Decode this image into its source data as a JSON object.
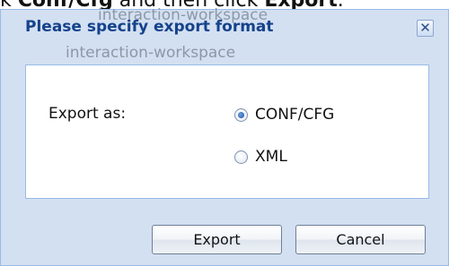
{
  "background": {
    "instruction_prefix": "k ",
    "instruction_bold1": "Conf/Cfg",
    "instruction_mid": " and then click ",
    "instruction_bold2": "Export",
    "instruction_suffix": ".",
    "ghost_text_1": "interaction-workspace",
    "ghost_text_2": "interaction-workspace"
  },
  "dialog": {
    "title": "Please specify export format",
    "close_glyph": "✕",
    "export_label": "Export as:",
    "options": [
      {
        "label": "CONF/CFG",
        "selected": true
      },
      {
        "label": "XML",
        "selected": false
      }
    ],
    "export_button": "Export",
    "cancel_button": "Cancel"
  },
  "colors": {
    "title": "#15428b",
    "dialog_bg": "#d3e0f1",
    "border": "#99bbe8"
  }
}
